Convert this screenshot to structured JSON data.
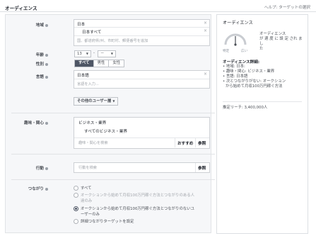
{
  "header": {
    "title": "オーディエンス",
    "help": "ヘルプ: ターゲットの選択"
  },
  "location": {
    "label": "地域",
    "country": "日本",
    "subitem": "日本すべて",
    "placeholder": "国、都道府県/州、市町村、郵便番号を追加"
  },
  "age": {
    "label": "年齢",
    "min": "13",
    "max": "－"
  },
  "gender": {
    "label": "性別",
    "options": [
      "すべて",
      "男性",
      "女性"
    ],
    "selected": "すべて"
  },
  "language": {
    "label": "言語",
    "value": "日本語",
    "placeholder": "言語を入力..."
  },
  "more_button": "その他のユーザー層",
  "interests": {
    "label": "趣味・関心",
    "category": "ビジネス・業界",
    "subitem": "すべてのビジネス・業界",
    "placeholder": "趣味・関心を検索",
    "suggest": "おすすめ",
    "browse": "参照"
  },
  "behaviors": {
    "label": "行動",
    "placeholder": "行動を検索",
    "browse": "参照"
  },
  "connections": {
    "label": "つながり",
    "options": [
      "すべて",
      "オーオークションから始めて月収100万円稼ぐ方法とつながりのある人",
      "オークションから始めて月収100万円稼ぐ方法とつながりのないユーザーのみ",
      "詳細つながりターゲットを設定"
    ],
    "option2_line1": "オークションから始めて月収100万円稼ぐ方法とつながりのある人",
    "option2_line2": "達のみ",
    "option3_line1": "オークションから始めて月収100万円稼ぐ方法とつながりのないユ",
    "option3_line2": "ーザーのみ",
    "selected_index": 2
  },
  "sidebar": {
    "title": "オーディエンス",
    "gauge_left": "特定",
    "gauge_right": "広い",
    "gauge_text_1": "オーディエンス",
    "gauge_text_2": "が 適 度 に 設 定 され まし",
    "gauge_text_3": "た",
    "gauge_level": 0.5,
    "details_heading": "オーディエンス詳細:",
    "details": [
      "地域: 日本:",
      "趣味・関心: ビジネス・業界",
      "言語: 日本語",
      "次とつながりがない: オークション",
      "から始めて月収100万円稼ぐ方法"
    ],
    "reach": "推定リーチ: 3,400,000人"
  },
  "colors": {
    "selected_tab": "#4e5665",
    "panel_bg": "#f6f7f9",
    "border": "#dddfe2"
  }
}
